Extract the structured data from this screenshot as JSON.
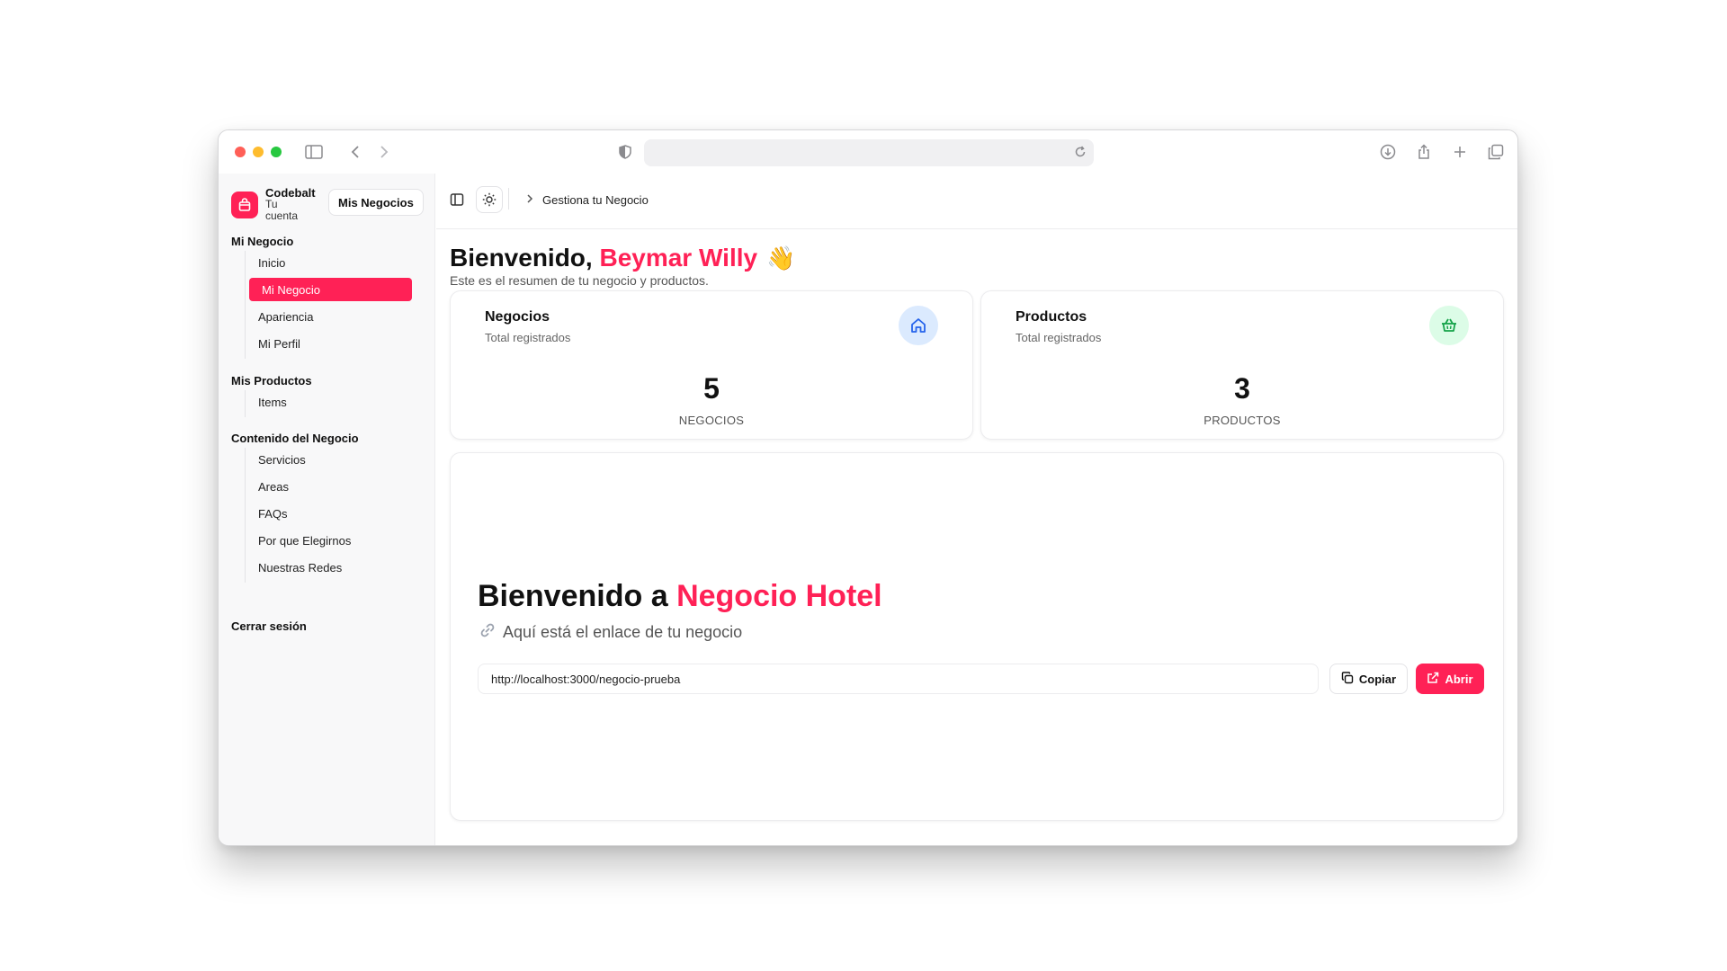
{
  "browser": {
    "url": "",
    "icons": [
      "sidebar-toggle-icon",
      "back-icon",
      "forward-icon",
      "shield-icon",
      "reload-icon",
      "download-icon",
      "share-icon",
      "new-tab-icon",
      "tabs-overview-icon"
    ]
  },
  "sidebar": {
    "brand": {
      "name": "Codebalt",
      "subtitle": "Tu cuenta"
    },
    "switch_button": "Mis Negocios",
    "groups": [
      {
        "title": "Mi Negocio",
        "items": [
          {
            "label": "Inicio",
            "active": false
          },
          {
            "label": "Mi Negocio",
            "active": true
          },
          {
            "label": "Apariencia",
            "active": false
          },
          {
            "label": "Mi Perfil",
            "active": false
          }
        ]
      },
      {
        "title": "Mis Productos",
        "items": [
          {
            "label": "Items",
            "active": false
          }
        ]
      },
      {
        "title": "Contenido del Negocio",
        "items": [
          {
            "label": "Servicios",
            "active": false
          },
          {
            "label": "Areas",
            "active": false
          },
          {
            "label": "FAQs",
            "active": false
          },
          {
            "label": "Por que Elegirnos",
            "active": false
          },
          {
            "label": "Nuestras Redes",
            "active": false
          }
        ]
      }
    ],
    "logout": "Cerrar sesión"
  },
  "topbar": {
    "breadcrumb": "Gestiona tu Negocio"
  },
  "welcome": {
    "prefix": "Bienvenido, ",
    "name": "Beymar Willy",
    "emoji": "👋",
    "subtitle": "Este es el resumen de tu negocio y productos."
  },
  "stats": [
    {
      "title": "Negocios",
      "subtitle": "Total registrados",
      "value": "5",
      "unit": "NEGOCIOS",
      "icon": "home-icon",
      "icon_bg": "#dbeafe",
      "icon_color": "#2563eb"
    },
    {
      "title": "Productos",
      "subtitle": "Total registrados",
      "value": "3",
      "unit": "PRODUCTOS",
      "icon": "basket-icon",
      "icon_bg": "#dcfce7",
      "icon_color": "#16a34a"
    }
  ],
  "business_link": {
    "prefix": "Bienvenido a ",
    "business_name": "Negocio Hotel",
    "subtitle": "Aquí está el enlace de tu negocio",
    "url": "http://localhost:3000/negocio-prueba",
    "copy_label": "Copiar",
    "open_label": "Abrir"
  },
  "colors": {
    "accent": "#ff2156"
  }
}
